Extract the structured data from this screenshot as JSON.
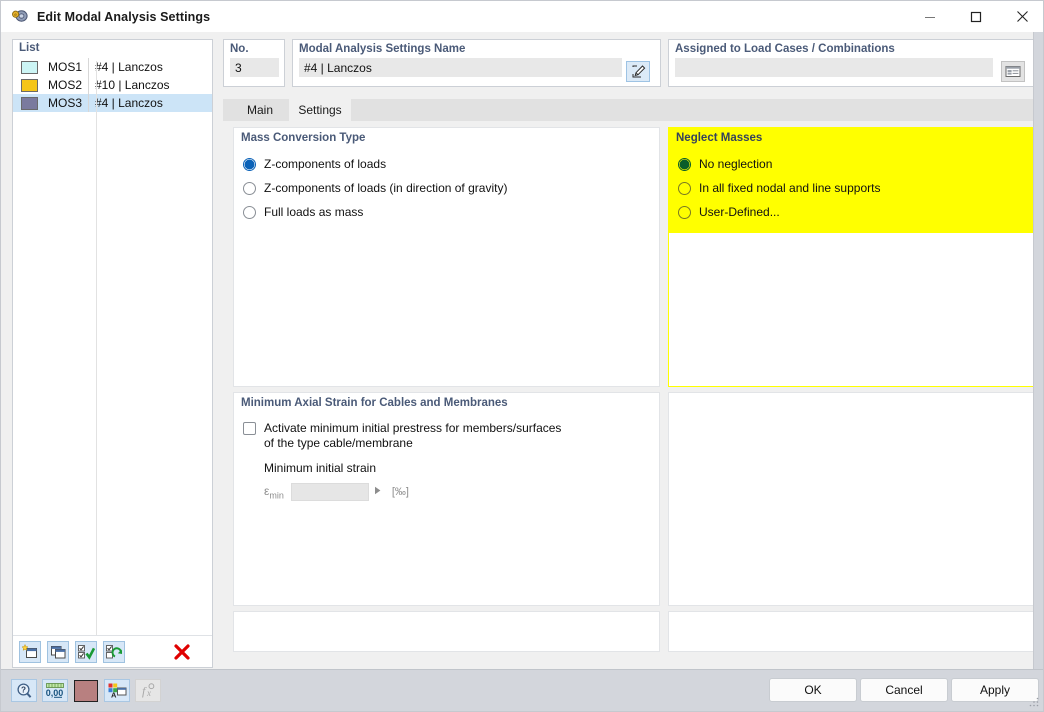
{
  "window": {
    "title": "Edit Modal Analysis Settings",
    "icon": "modal-analysis-icon",
    "minimize": "–",
    "maximize": "□",
    "close": "✕"
  },
  "list": {
    "header": "List",
    "rows": [
      {
        "color": "#ccf5f5",
        "code": "MOS1",
        "desc": "#4 | Lanczos",
        "selected": false
      },
      {
        "color": "#f5c518",
        "code": "MOS2",
        "desc": "#10 | Lanczos",
        "selected": false
      },
      {
        "color": "#7a7a9e",
        "code": "MOS3",
        "desc": "#4 | Lanczos",
        "selected": true
      }
    ],
    "toolbar": [
      {
        "name": "new-item-button",
        "icon": "new-window-star-icon"
      },
      {
        "name": "copy-item-button",
        "icon": "copy-windows-icon"
      },
      {
        "name": "select-all-button",
        "icon": "checklist-check-icon"
      },
      {
        "name": "invert-selection-button",
        "icon": "checklist-refresh-icon"
      },
      {
        "name": "delete-item-button",
        "icon": "red-x-icon"
      }
    ]
  },
  "no_group": {
    "label": "No.",
    "value": "3"
  },
  "name_group": {
    "label": "Modal Analysis Settings Name",
    "value": "#4 | Lanczos",
    "edit_button": "pencil-edit-icon"
  },
  "assigned_group": {
    "label": "Assigned to Load Cases / Combinations",
    "value": "",
    "edit_button": "table-list-icon"
  },
  "tabs": [
    {
      "label": "Main",
      "active": false
    },
    {
      "label": "Settings",
      "active": true
    }
  ],
  "mass_conversion": {
    "title": "Mass Conversion Type",
    "options": [
      {
        "label": "Z-components of loads",
        "checked": true
      },
      {
        "label": "Z-components of loads (in direction of gravity)",
        "checked": false
      },
      {
        "label": "Full loads as mass",
        "checked": false
      }
    ]
  },
  "neglect_masses": {
    "title": "Neglect Masses",
    "highlight_color": "#ffff00",
    "options": [
      {
        "label": "No neglection",
        "checked": true
      },
      {
        "label": "In all fixed nodal and line supports",
        "checked": false
      },
      {
        "label": "User-Defined...",
        "checked": false
      }
    ]
  },
  "min_axial_strain": {
    "title": "Minimum Axial Strain for Cables and Membranes",
    "checkbox_label_line1": "Activate minimum initial prestress for members/surfaces",
    "checkbox_label_line2": "of the type cable/membrane",
    "checked": false,
    "sub_label": "Minimum initial strain",
    "field_symbol": "ε",
    "field_subscript": "min",
    "field_value": "",
    "unit": "[‰]"
  },
  "bottom": {
    "icons": [
      {
        "name": "help-button",
        "icon": "question-magnifier-icon",
        "disabled": false
      },
      {
        "name": "units-button",
        "icon": "numeric-units-icon",
        "disabled": false
      },
      {
        "name": "color-button",
        "icon": "color-swatch-icon",
        "disabled": false
      },
      {
        "name": "display-props-button",
        "icon": "display-properties-icon",
        "disabled": false
      },
      {
        "name": "formula-button",
        "icon": "function-fx-icon",
        "disabled": true
      }
    ],
    "ok": "OK",
    "cancel": "Cancel",
    "apply": "Apply"
  }
}
